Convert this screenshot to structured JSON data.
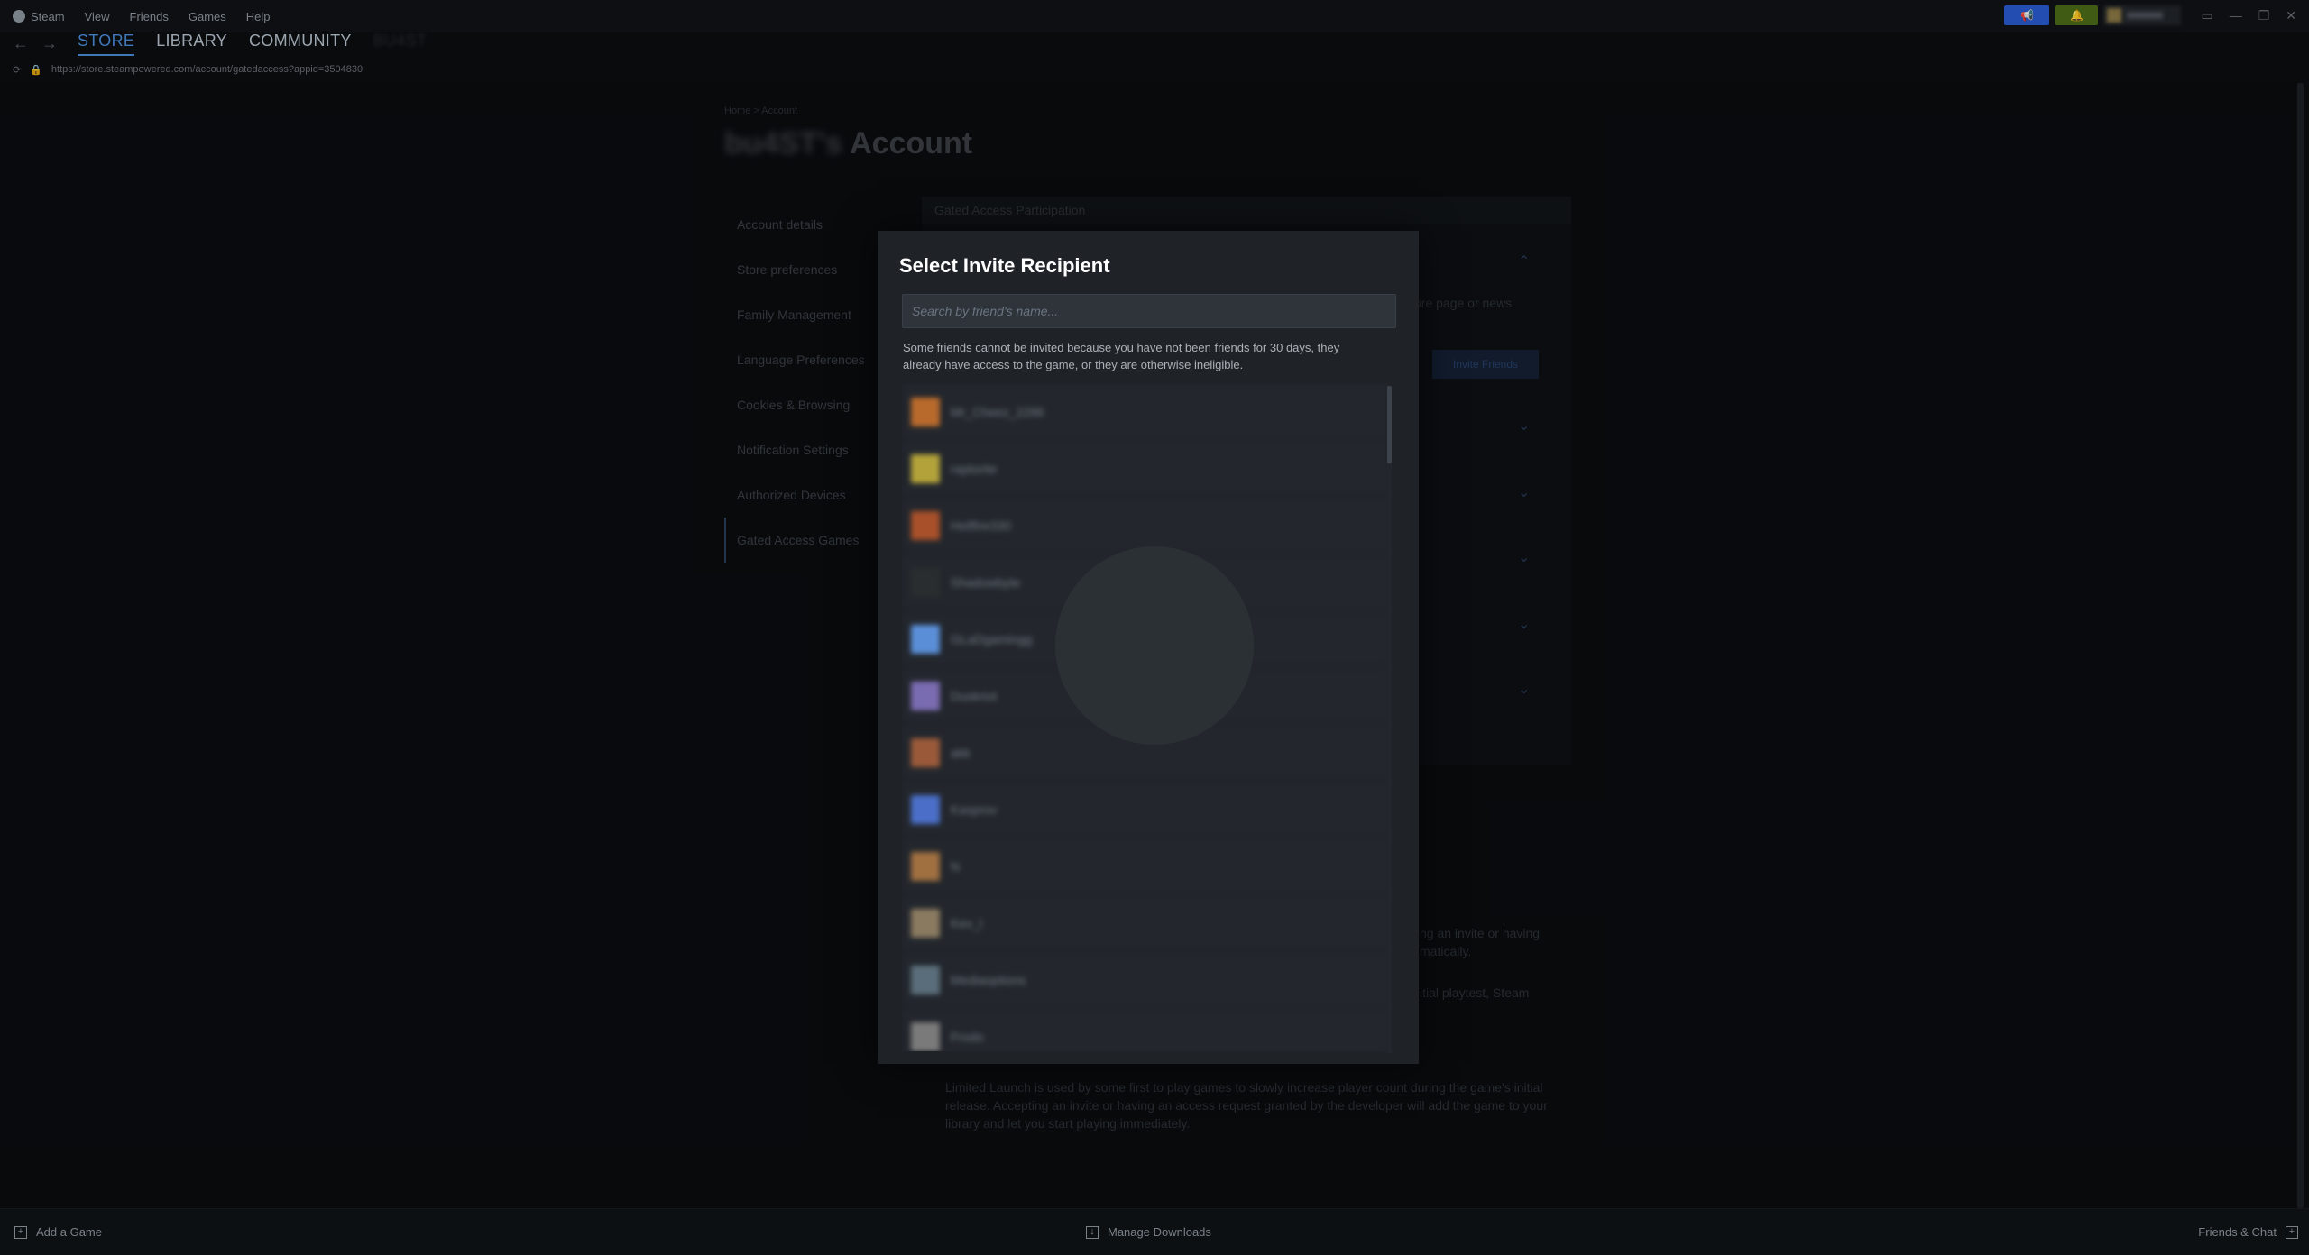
{
  "menu": {
    "steam": "Steam",
    "view": "View",
    "friends": "Friends",
    "games": "Games",
    "help": "Help"
  },
  "nav": {
    "store": "STORE",
    "library": "LIBRARY",
    "community": "COMMUNITY",
    "username": "BU4ST"
  },
  "url": "https://store.steampowered.com/account/gatedaccess?appid=3504830",
  "page": {
    "breadcrumb": "Home > Account",
    "title_user": "bu4ST's",
    "title_suffix": " Account",
    "sidebar": [
      "Account details",
      "Store preferences",
      "Family Management",
      "Language Preferences",
      "Cookies & Browsing",
      "Notification Settings",
      "Authorized Devices",
      "Gated Access Games"
    ],
    "panel_header": "Gated Access Participation",
    "panel_snippet": "ore page or news",
    "invite_btn": "Invite Friends",
    "bg_text_1": "ng an invite or having",
    "bg_text_2": "matically.",
    "bg_text_3": "itial playtest, Steam",
    "bg_text_4": "Limited Launch is used by some first to play games to slowly increase player count during the game's initial release. Accepting an invite or having an access request granted by the developer will add the game to your library and let you start playing immediately."
  },
  "dialog": {
    "title": "Select Invite Recipient",
    "search_placeholder": "Search by friend's name...",
    "notice": "Some friends cannot be invited because you have not been friends for 30 days, they already have access to the game, or they are otherwise ineligible.",
    "friends": [
      {
        "name": "Mr_Cheez_2286",
        "color": "#b86a2c"
      },
      {
        "name": "raptorite",
        "color": "#b3a23a"
      },
      {
        "name": "Hellfire330",
        "color": "#a8502a"
      },
      {
        "name": "Shadowbyte",
        "color": "#2a2d2f"
      },
      {
        "name": "GLaDgamingg",
        "color": "#5a8fd8"
      },
      {
        "name": "Duskriot",
        "color": "#7a6cb0"
      },
      {
        "name": "akk",
        "color": "#9a5a3a"
      },
      {
        "name": "Kasprov",
        "color": "#4b6fc8"
      },
      {
        "name": "N",
        "color": "#a07040"
      },
      {
        "name": "Kev_l",
        "color": "#8a7a60"
      },
      {
        "name": "Mediaoptions",
        "color": "#5a6d7a"
      },
      {
        "name": "Frodo",
        "color": "#7a7a7a"
      }
    ]
  },
  "bottom": {
    "add_game": "Add a Game",
    "downloads": "Manage Downloads",
    "friends_chat": "Friends & Chat"
  }
}
